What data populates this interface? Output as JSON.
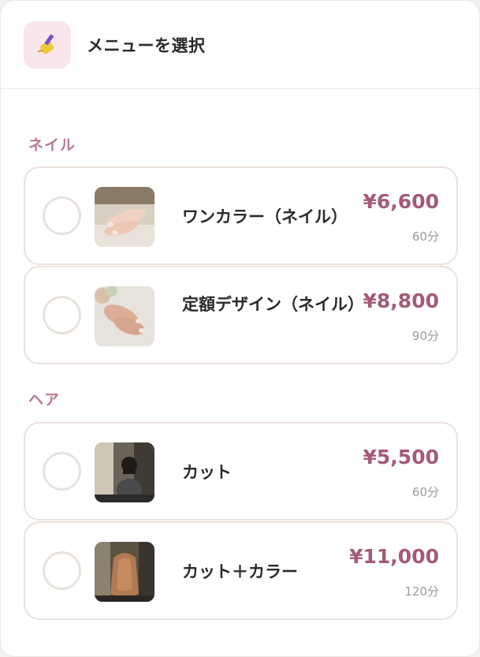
{
  "header": {
    "title": "メニューを選択",
    "icon": "nail-polish-icon"
  },
  "colors": {
    "accent": "#a45a78",
    "section_label": "#b87a92",
    "border": "#ebe1dc"
  },
  "sections": [
    {
      "label": "ネイル",
      "items": [
        {
          "name": "ワンカラー（ネイル）",
          "price": "¥6,600",
          "duration": "60分"
        },
        {
          "name": "定額デザイン（ネイル）",
          "price": "¥8,800",
          "duration": "90分"
        }
      ]
    },
    {
      "label": "ヘア",
      "items": [
        {
          "name": "カット",
          "price": "¥5,500",
          "duration": "60分"
        },
        {
          "name": "カット＋カラー",
          "price": "¥11,000",
          "duration": "120分"
        }
      ]
    }
  ]
}
